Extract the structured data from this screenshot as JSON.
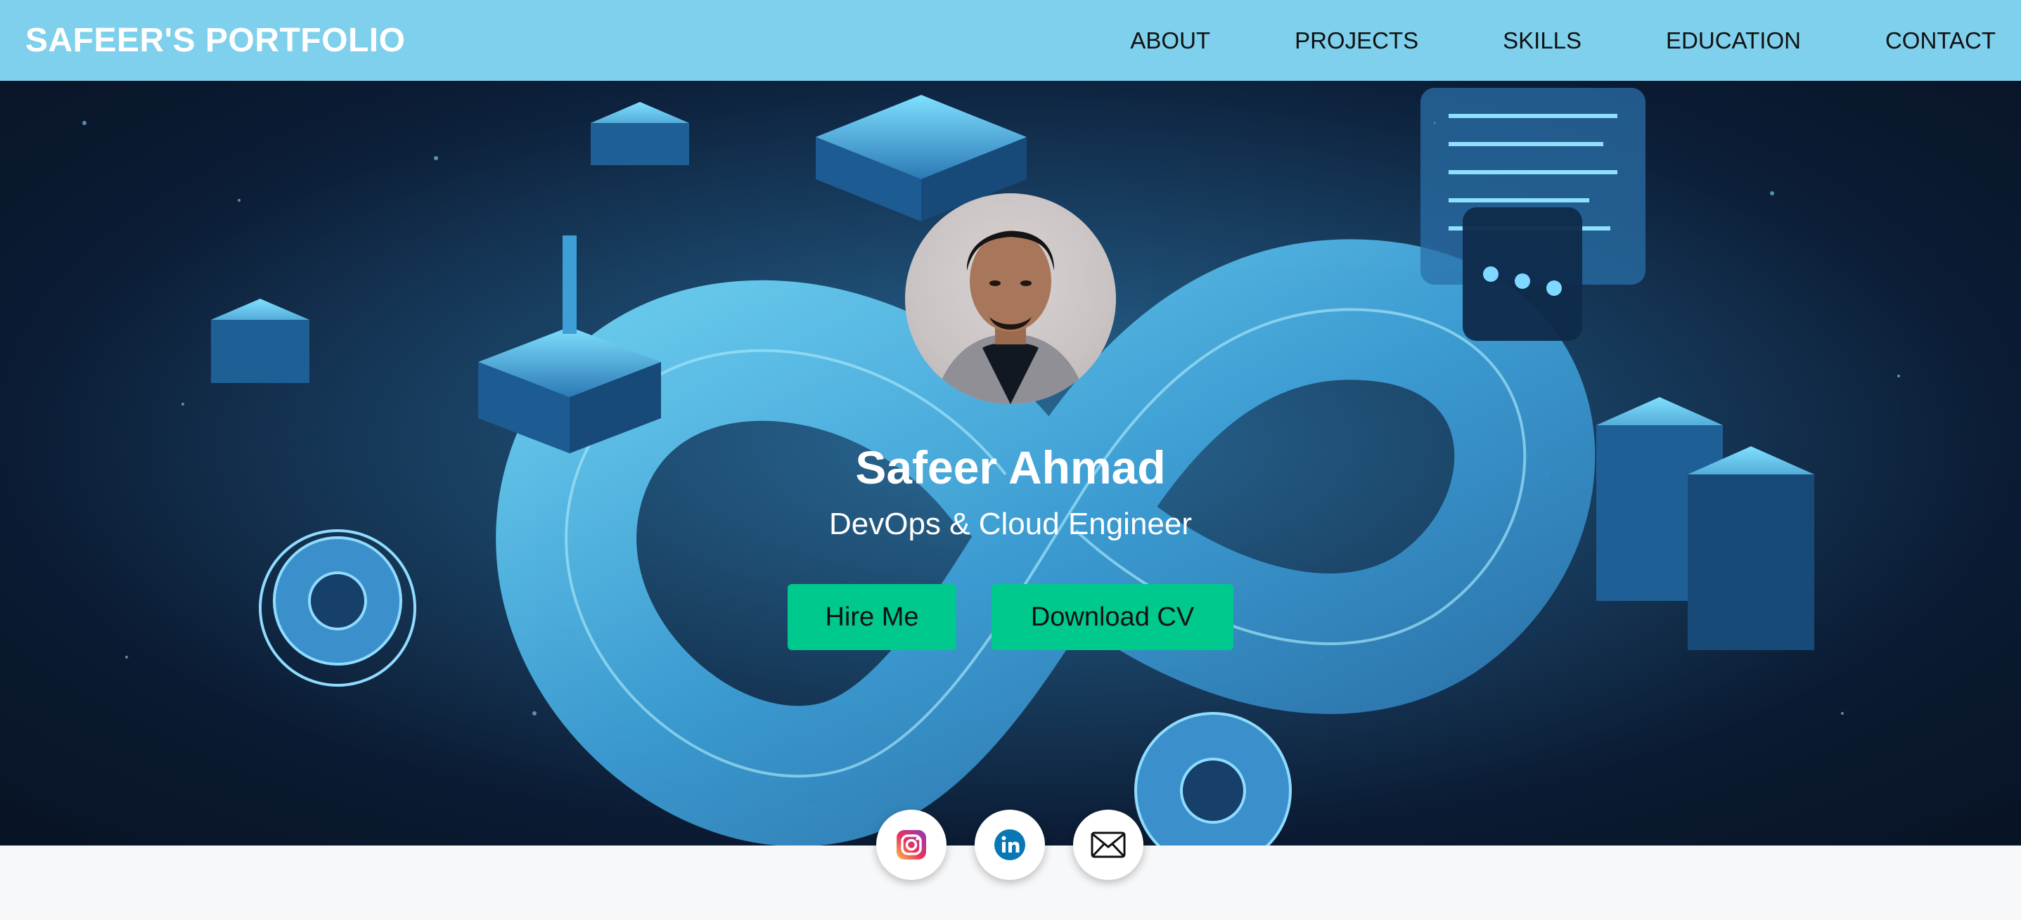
{
  "brand": "SAFEER'S PORTFOLIO",
  "nav": {
    "about": "ABOUT",
    "projects": "PROJECTS",
    "skills": "SKILLS",
    "education": "EDUCATION",
    "contact": "CONTACT"
  },
  "hero": {
    "name": "Safeer Ahmad",
    "title": "DevOps & Cloud Engineer",
    "hire_label": "Hire Me",
    "cv_label": "Download CV"
  },
  "socials": [
    "instagram-icon",
    "linkedin-icon",
    "mail-icon"
  ],
  "colors": {
    "navbar": "#7ed0ec",
    "button": "#00c98d",
    "hero_bg": "#0b1b33"
  }
}
